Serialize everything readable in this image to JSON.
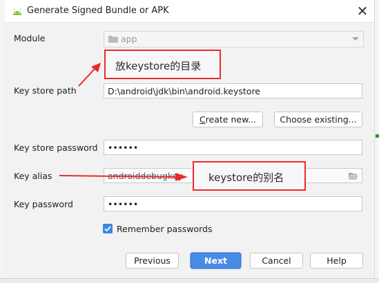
{
  "dialog": {
    "title": "Generate Signed Bundle or APK",
    "close_symbol": "✕"
  },
  "form": {
    "module_label": "Module",
    "module_value": "app",
    "keystore_path_label": "Key store path",
    "keystore_path_value": "D:\\android\\jdk\\bin\\android.keystore",
    "create_new_label": "Create new...",
    "choose_existing_label": "Choose existing...",
    "keystore_password_label": "Key store password",
    "keystore_password_value": "••••••",
    "key_alias_label": "Key alias",
    "key_alias_value": "androiddebugkey",
    "key_password_label": "Key password",
    "key_password_value": "••••••",
    "remember_label": "Remember passwords",
    "remember_checked": true
  },
  "buttons": {
    "previous": "Previous",
    "next": "Next",
    "cancel": "Cancel",
    "help": "Help"
  },
  "annotations": {
    "keystore_dir": "放keystore的目录",
    "keystore_alias": "keystore的别名"
  },
  "icons": {
    "title": "android-icon",
    "module": "folder-icon",
    "browse": "folder-open-icon",
    "checkbox": "checkmark-icon"
  },
  "colors": {
    "accent": "#4a8be6",
    "annotation": "#ea2a2a",
    "dialog_bg": "#f2f2f2"
  }
}
